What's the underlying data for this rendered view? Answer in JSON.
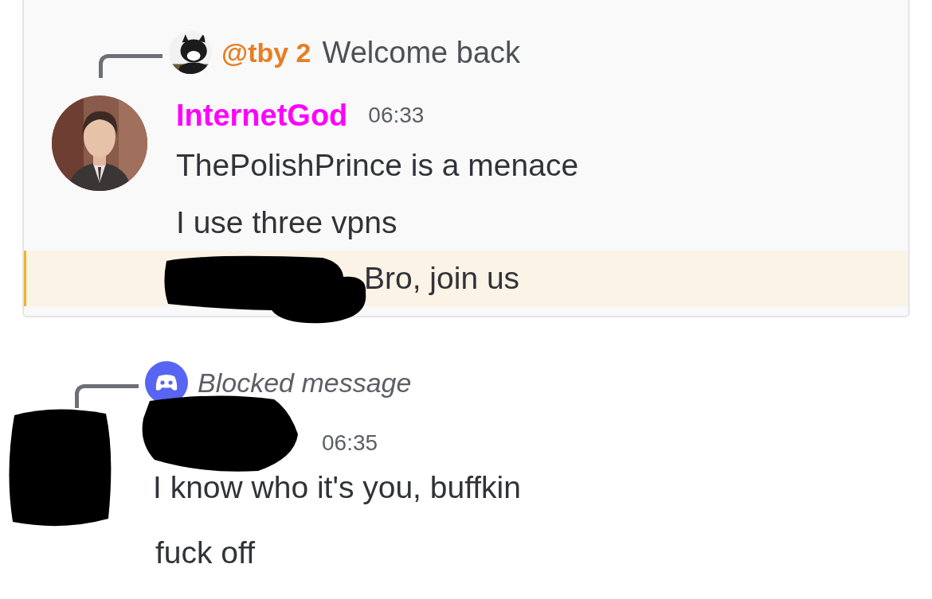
{
  "messages": [
    {
      "highlighted": true,
      "redacted": false,
      "reply": {
        "kind": "user",
        "author": "@tby 2",
        "text": "Welcome back"
      },
      "author": "InternetGod",
      "color": "#ff00ff",
      "time": "06:33",
      "lines": [
        {
          "text": "ThePolishPrince is a menace",
          "mention": false,
          "redacted": false
        },
        {
          "text": "I use three vpns",
          "mention": false,
          "redacted": false
        },
        {
          "text": "Bro, join us",
          "mention": true,
          "redacted": true
        }
      ]
    },
    {
      "highlighted": false,
      "redacted": true,
      "reply": {
        "kind": "blocked",
        "text": "Blocked message"
      },
      "time": "06:35",
      "lines": [
        {
          "text": "I know who it's you, buffkin",
          "mention": false,
          "redacted": false
        },
        {
          "text": "fuck off",
          "mention": false,
          "redacted": false
        }
      ]
    }
  ]
}
